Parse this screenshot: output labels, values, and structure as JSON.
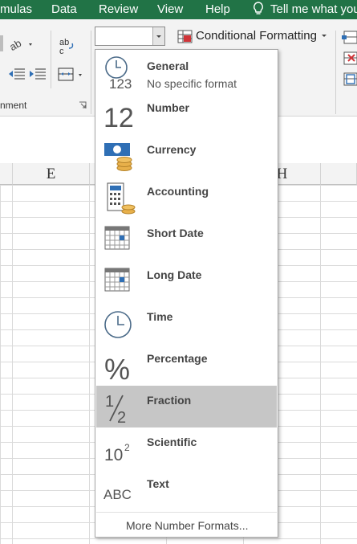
{
  "menubar": {
    "items": [
      "mulas",
      "Data",
      "Review",
      "View",
      "Help"
    ],
    "tell_me": "Tell me what you"
  },
  "ribbon": {
    "alignment_group_label": "nment",
    "conditional_formatting": "Conditional Formatting",
    "number_format_value": ""
  },
  "columns": [
    "E",
    "H"
  ],
  "number_format_menu": {
    "items": [
      {
        "label": "General",
        "sub": "No specific format",
        "icon": "clock-123-icon"
      },
      {
        "label": "Number",
        "sub": "",
        "icon": "number-12-icon"
      },
      {
        "label": "Currency",
        "sub": "",
        "icon": "currency-icon"
      },
      {
        "label": "Accounting",
        "sub": "",
        "icon": "accounting-icon"
      },
      {
        "label": "Short Date",
        "sub": "",
        "icon": "calendar-icon"
      },
      {
        "label": "Long Date",
        "sub": "",
        "icon": "calendar-icon"
      },
      {
        "label": "Time",
        "sub": "",
        "icon": "clock-icon"
      },
      {
        "label": "Percentage",
        "sub": "",
        "icon": "percent-icon"
      },
      {
        "label": "Fraction",
        "sub": "",
        "icon": "fraction-icon"
      },
      {
        "label": "Scientific",
        "sub": "",
        "icon": "scientific-icon"
      },
      {
        "label": "Text",
        "sub": "",
        "icon": "text-abc-icon"
      }
    ],
    "selected": "Fraction",
    "more": "More Number Formats..."
  },
  "colors": {
    "excel_green": "#217346",
    "selected_bg": "#c6c6c6"
  }
}
